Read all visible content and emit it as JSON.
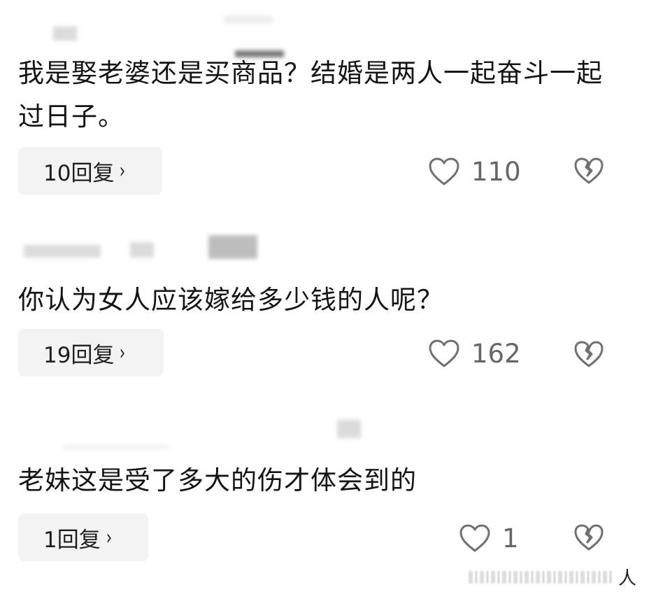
{
  "comments": [
    {
      "text": "我是娶老婆还是买商品？结婚是两人一起奋斗一起过日子。",
      "replies_label": "10回复",
      "likes": "110"
    },
    {
      "text": "你认为女人应该嫁给多少钱的人呢？",
      "replies_label": "19回复",
      "likes": "162"
    },
    {
      "text": "老妹这是受了多大的伤才体会到的",
      "replies_label": "1回复",
      "likes": "1"
    }
  ],
  "footer": {
    "char": "人"
  },
  "colors": {
    "text": "#141414",
    "muted": "#666666",
    "reply_bg": "#f3f3f3",
    "icon_stroke": "#707070"
  },
  "icons": {
    "like": "heart-outline-icon",
    "dislike": "broken-heart-icon",
    "chevron": "chevron-right-icon"
  }
}
